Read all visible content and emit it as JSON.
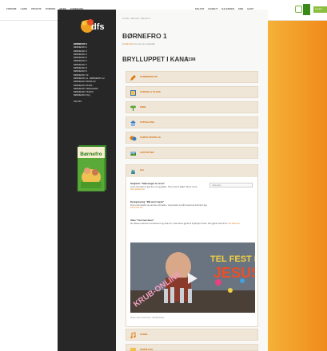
{
  "topnav": {
    "left": [
      "FORSIDE",
      "LÆRE",
      "PRAKTIK",
      "FORSIDE",
      "MADE",
      "FORENLING"
    ],
    "right": [
      "SPLANT",
      "KANDUT",
      "KALENDER",
      "KRB",
      "GANT"
    ],
    "login_label": "Log ind"
  },
  "logo": {
    "text": "dfs"
  },
  "sidebar": {
    "items": [
      "BØRNEFRO 1",
      "BØRNEFRO 2",
      "BØRNEFRO 3",
      "BØRNEFRO 4",
      "BØRNEFRO 5",
      "BØRNEFRO 6",
      "BØRNEFRO 7",
      "BØRNEFRO 8",
      "BØRNEFRO 9",
      "BØRNEFRO 10",
      "BØRNEFRO 11 - BØRNEFRO 12",
      "BØRNEFRO ÅRSPLAN",
      "BØRNEFRO MUSIK",
      "BØRNEFRO TEMAGRAM",
      "BØRNEFRO TILBUD",
      "BØRNEFRO FAQ"
    ],
    "extra": "OM DFS"
  },
  "book": {
    "title": "Børnefro"
  },
  "main": {
    "breadcrumb": "Forside › Børnefro › Børnefro 1",
    "page_title": "BØRNEFRO 1",
    "subtitle_prefix": "Se ",
    "subtitle_link": "Børnefro",
    "subtitle_suffix": " for mere om materialet",
    "lesson_title": "BRYLLUPPET I KANA",
    "lesson_number": "T198"
  },
  "sections": [
    "Forberedelse",
    "Samling & Tilbud",
    "Bibel",
    "Fortælling",
    "Samtaleforslag",
    "Aktiviteter",
    "Bøn",
    "Sange",
    "Download"
  ],
  "prayer": {
    "title": "Bøn",
    "p1_title": "Sangtekst: \"Takkesangen for Jesus\"",
    "p1_text": "Jesus har givet os god fest, vin og glæde. Hvem skal vi takke? Hurra, hurra.",
    "p1_link": "Hent teksten her",
    "select_label": "Vælg sang",
    "p2_title": "Bevægelsesleg: \"Mål vand i kande\"",
    "p2_text": "Find et par kander og sæt dem på række. Læg kander op på hovedet og hold dem lige.",
    "p2_link": "Læs mere her",
    "p3_title": "Video: \"Fest med Jesus\"",
    "p3_text": "Se videoen sammen med børnene og snak om, hvad Jesus gjorde til brylluppet i Kana. Han gjorde vand til vin.",
    "p3_link": "Se video her",
    "video_overlay_1": "TEL FEST MED",
    "video_overlay_2": "JESUS",
    "video_overlay_3": "KRUB-ONLINE",
    "video_caption": "Video: Fest med Jesus - KRUB Online"
  },
  "colors": {
    "accent": "#e07b10",
    "dark": "#272727",
    "section_bg": "#f0e6d8",
    "green": "#3a8a1a"
  }
}
